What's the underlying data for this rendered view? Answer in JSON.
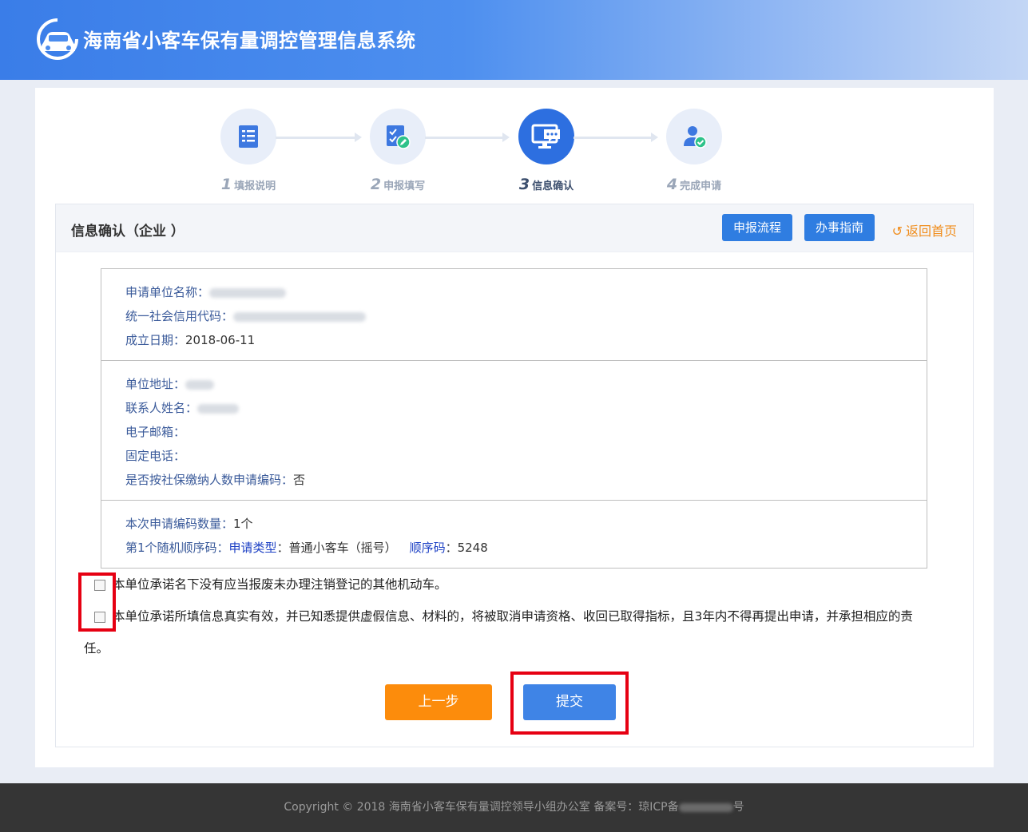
{
  "header": {
    "title": "海南省小客车保有量调控管理信息系统",
    "logo_icon": "car-logo-icon"
  },
  "steps": [
    {
      "num": "1",
      "label": "填报说明",
      "icon": "form-list-icon",
      "active": false
    },
    {
      "num": "2",
      "label": "申报填写",
      "icon": "edit-form-icon",
      "active": false
    },
    {
      "num": "3",
      "label": "信息确认",
      "icon": "monitor-chat-icon",
      "active": true
    },
    {
      "num": "4",
      "label": "完成申请",
      "icon": "user-check-icon",
      "active": false
    }
  ],
  "panel": {
    "title": "信息确认（企业  ）",
    "btn_process": "申报流程",
    "btn_guide": "办事指南",
    "back_home": "返回首页"
  },
  "info": {
    "company_name_label": "申请单位名称：",
    "credit_code_label": "统一社会信用代码：",
    "found_date_label": "成立日期：",
    "found_date_value": "2018-06-11",
    "address_label": "单位地址：",
    "contact_label": "联系人姓名：",
    "email_label": "电子邮箱：",
    "phone_label": "固定电话：",
    "social_label": "是否按社保缴纳人数申请编码：",
    "social_value": "否",
    "count_label": "本次申请编码数量：",
    "count_value": "1个",
    "random_label": "第1个随机顺序码：",
    "type_label": "申请类型",
    "type_value": "：普通小客车（摇号）",
    "seq_label": "顺序码",
    "seq_value": "：5248"
  },
  "commitments": {
    "c1": "本单位承诺名下没有应当报废未办理注销登记的其他机动车。",
    "c2": "本单位承诺所填信息真实有效，并已知悉提供虚假信息、材料的，将被取消申请资格、收回已取得指标，且3年内不得再提出申请，并承担相应的责",
    "c2_cont": "任。"
  },
  "buttons": {
    "prev": "上一步",
    "submit": "提交"
  },
  "footer": {
    "copyright": "Copyright  © 2018    海南省小客车保有量调控领导小组办公室     备案号：琼ICP备",
    "suffix": "号"
  },
  "colors": {
    "primary": "#2f7de1",
    "orange": "#fc8c0c",
    "highlight": "#e60012"
  }
}
